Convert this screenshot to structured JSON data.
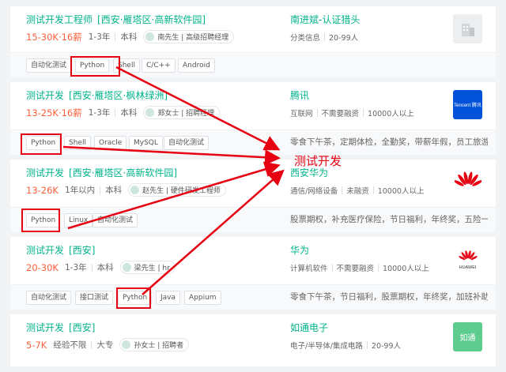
{
  "jobs": [
    {
      "title": "测试开发工程师",
      "location": "[西安·雁塔区·高新软件园]",
      "salary": "15-30K·16薪",
      "experience": "1-3年",
      "education": "本科",
      "recruiter": "南先生 | 高级招聘经理",
      "company": "南进斌-认证猎头",
      "company_info": [
        "分类信息",
        "20-99人"
      ],
      "tags": [
        "自动化测试",
        "Python",
        "Shell",
        "C/C++",
        "Android"
      ],
      "logo": "building-icon"
    },
    {
      "title": "测试开发",
      "location": "[西安·雁塔区·枫林绿洲]",
      "salary": "13-25K·16薪",
      "experience": "1-3年",
      "education": "本科",
      "recruiter": "郑女士 | 招聘经理",
      "company": "腾讯",
      "company_info": [
        "互联网",
        "不需要融资",
        "10000人以上"
      ],
      "tags": [
        "Python",
        "Shell",
        "Oracle",
        "MySQL",
        "自动化测试"
      ],
      "benefits": "零食下午茶，定期体检，全勤奖，带薪年假，员工旅游，...",
      "logo": "Tencent 腾讯",
      "logo_color": "#0052d9"
    },
    {
      "title": "测试开发",
      "location": "[西安·雁塔区·高新软件园]",
      "salary": "13-26K",
      "experience": "1年以内",
      "education": "本科",
      "recruiter": "赵先生 | 硬件研发工程师",
      "company": "西安华为",
      "company_info": [
        "通信/网络设备",
        "未融资",
        "10000人以上"
      ],
      "tags": [
        "Python",
        "Linux",
        "自动化测试"
      ],
      "benefits": "股票期权，补充医疗保险，节日福利，年终奖，五险一金...",
      "logo": "huawei-icon"
    },
    {
      "title": "测试开发",
      "location": "[西安]",
      "salary": "20-30K",
      "experience": "1-3年",
      "education": "本科",
      "recruiter": "梁先生 | hr",
      "company": "华为",
      "company_info": [
        "计算机软件",
        "不需要融资",
        "10000人以上"
      ],
      "tags": [
        "自动化测试",
        "接口测试",
        "Python",
        "Java",
        "Appium"
      ],
      "benefits": "零食下午茶，节日福利，股票期权，年终奖，加班补助，...",
      "logo": "HUAWEI",
      "logo_color": "#e60012"
    },
    {
      "title": "测试开发",
      "location": "[西安]",
      "salary": "5-7K",
      "experience": "经验不限",
      "education": "大专",
      "recruiter": "孙女士 | 招聘者",
      "company": "如通电子",
      "company_info": [
        "电子/半导体/集成电路",
        "20-99人"
      ],
      "logo": "如通",
      "logo_color": "#5ecb8f"
    }
  ],
  "overlay_label": "测试开发"
}
